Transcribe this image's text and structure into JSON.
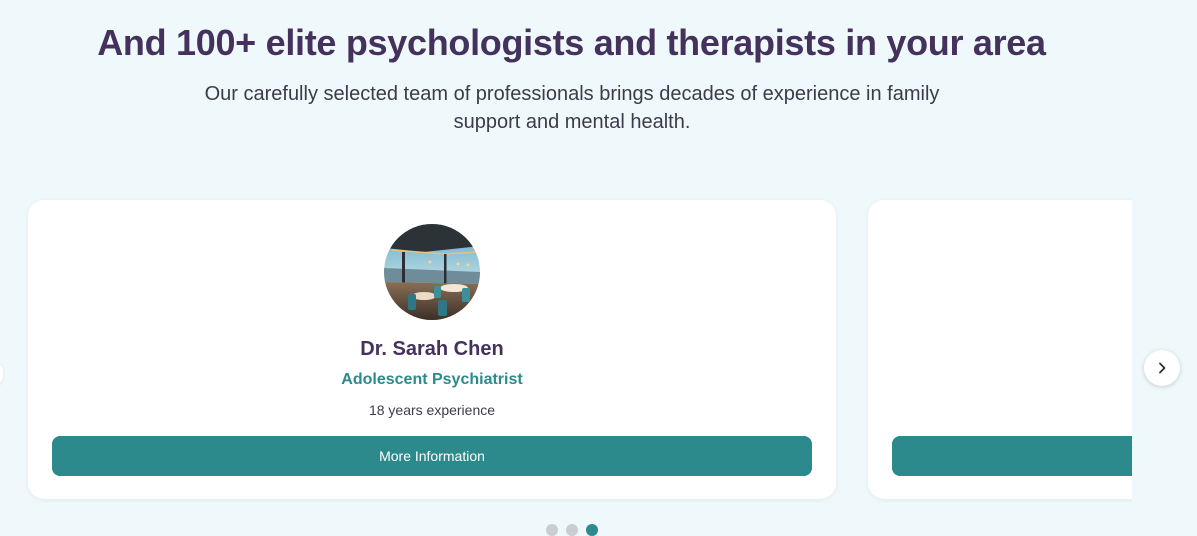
{
  "header": {
    "title": "And 100+ elite psychologists and therapists in your area",
    "subtitle": "Our carefully selected team of professionals brings decades of experience in family support and mental health."
  },
  "carousel": {
    "cards": [
      {
        "name": "Dr. Sarah Chen",
        "role": "Adolescent Psychiatrist",
        "experience": "18 years experience",
        "button_label": "More Information"
      }
    ],
    "next_icon": "chevron-right-icon",
    "pagination": {
      "total": 3,
      "active": 3
    }
  },
  "colors": {
    "background": "#eff8fa",
    "heading": "#44325c",
    "accent": "#2d8a8c",
    "card": "#ffffff"
  }
}
